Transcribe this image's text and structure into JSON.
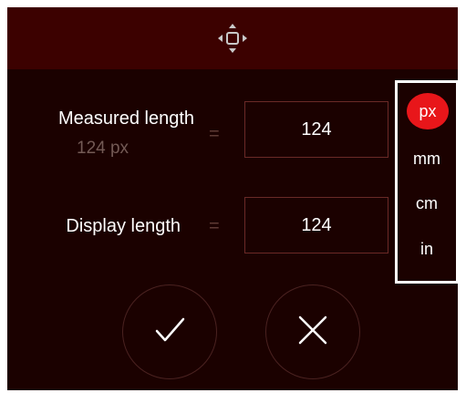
{
  "header": {
    "move_icon": "move-arrows-icon"
  },
  "measured": {
    "label": "Measured length",
    "sublabel": "124 px",
    "equals": "=",
    "value": "124"
  },
  "display": {
    "label": "Display length",
    "equals": "=",
    "value": "124"
  },
  "units": {
    "selected": "px",
    "items": [
      "px",
      "mm",
      "cm",
      "in"
    ]
  },
  "actions": {
    "confirm_icon": "checkmark-icon",
    "cancel_icon": "close-icon"
  },
  "colors": {
    "panel_bg": "#1b0100",
    "header_bg": "#3c0100",
    "accent": "#e8161a"
  }
}
